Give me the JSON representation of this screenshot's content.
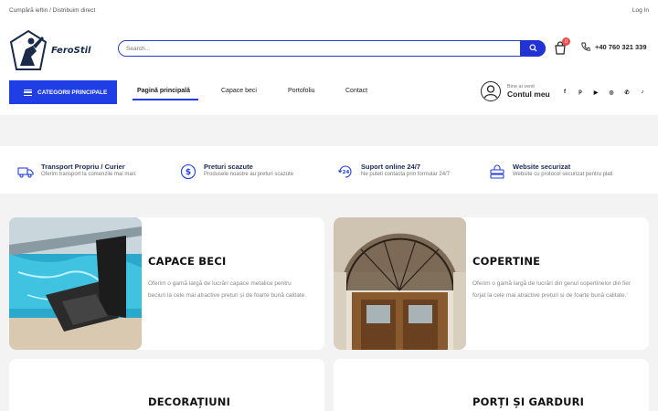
{
  "topbar": {
    "tagline": "Cumpără ieftin / Distribuim direct",
    "login": "Log In"
  },
  "logo": {
    "text": "FeroStil"
  },
  "search": {
    "placeholder": "Search..."
  },
  "cart": {
    "count": "0"
  },
  "phone": {
    "number": "+40 760 321 339"
  },
  "nav": {
    "categories_label": "CATEGORII PRINCIPALE",
    "items": [
      {
        "label": "Pagină principală"
      },
      {
        "label": "Capace beci"
      },
      {
        "label": "Portofoliu"
      },
      {
        "label": "Contact"
      }
    ]
  },
  "account": {
    "greeting": "Bine ai venit",
    "label": "Contul meu"
  },
  "socials": [
    "f",
    "p",
    "▶",
    "◎",
    "✆",
    "♪"
  ],
  "features": [
    {
      "icon": "truck-icon",
      "title": "Transport Propriu / Curier",
      "desc": "Oferim transport la comenzile mai mari."
    },
    {
      "icon": "dollar-coin-icon",
      "title": "Preturi scazute",
      "desc": "Produsele noastre au preturi scazute"
    },
    {
      "icon": "support-24-icon",
      "title": "Suport online 24/7",
      "desc": "Ne puteti contacta prin formular 24/7"
    },
    {
      "icon": "secure-server-icon",
      "title": "Website securizat",
      "desc": "Website cu protocol securizat pentru plati"
    }
  ],
  "cards": [
    {
      "title": "CAPACE BECI",
      "desc": "Oferim o gamă largă de lucrări capace metalice pentru beciuri la cele mai atractive prețuri și de foarte bună calitate."
    },
    {
      "title": "COPERTINE",
      "desc": "Oferim o gamă largă de lucrări din genul copertinelor din fier forjat la cele mai atractive prețuri și de foarte bună calitate."
    },
    {
      "title": "DECORAȚIUNI",
      "desc": ""
    },
    {
      "title": "PORȚI ȘI GARDURI",
      "desc": ""
    }
  ],
  "colors": {
    "accent": "#1f3ee6",
    "badge": "#ef4b4b",
    "dark": "#1a2a5a"
  }
}
